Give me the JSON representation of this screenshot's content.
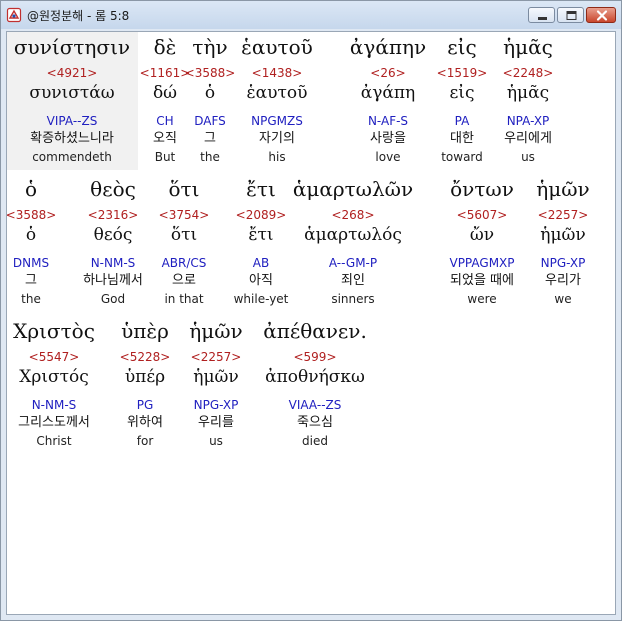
{
  "window": {
    "title": "@원정분해 - 롬 5:8",
    "icon": "bible-app-icon",
    "buttons": [
      "minimize-icon",
      "maximize-icon",
      "close-icon"
    ]
  },
  "colors": {
    "strongs": "#b02020",
    "morph": "#2020c0",
    "text": "#111111",
    "highlight": "#f1f1f1"
  },
  "lines": [
    {
      "words": [
        {
          "greek": "συνίστησιν",
          "strongs": "<4921>",
          "lemma": "συνιστάω",
          "morph": "VIPA--ZS",
          "korean": "확증하셨느니라",
          "english": "commendeth"
        },
        {
          "greek": "δὲ",
          "strongs": "<1161>",
          "lemma": "δώ",
          "morph": "CH",
          "korean": "오직",
          "english": "But"
        },
        {
          "greek": "τὴν",
          "strongs": "<3588>",
          "lemma": "ὁ",
          "morph": "DAFS",
          "korean": "그",
          "english": "the"
        },
        {
          "greek": "ἑαυτοῦ",
          "strongs": "<1438>",
          "lemma": "ἑαυτοῦ",
          "morph": "NPGMZS",
          "korean": "자기의",
          "english": "his"
        },
        {
          "greek": "ἀγάπην",
          "strongs": "<26>",
          "lemma": "ἀγάπη",
          "morph": "N-AF-S",
          "korean": "사랑을",
          "english": "love"
        },
        {
          "greek": "εἰς",
          "strongs": "<1519>",
          "lemma": "εἰς",
          "morph": "PA",
          "korean": "대한",
          "english": "toward"
        },
        {
          "greek": "ἡμᾶς",
          "strongs": "<2248>",
          "lemma": "ἡμᾶς",
          "morph": "NPA-XP",
          "korean": "우리에게",
          "english": "us"
        }
      ]
    },
    {
      "words": [
        {
          "greek": "ὁ",
          "strongs": "<3588>",
          "lemma": "ὁ",
          "morph": "DNMS",
          "korean": "그",
          "english": "the"
        },
        {
          "greek": "θεὸς",
          "strongs": "<2316>",
          "lemma": "θεός",
          "morph": "N-NM-S",
          "korean": "하나님께서",
          "english": "God"
        },
        {
          "greek": "ὅτι",
          "strongs": "<3754>",
          "lemma": "ὅτι",
          "morph": "ABR/CS",
          "korean": "으로",
          "english": "in that"
        },
        {
          "greek": "ἔτι",
          "strongs": "<2089>",
          "lemma": "ἔτι",
          "morph": "AB",
          "korean": "아직",
          "english": "while-yet"
        },
        {
          "greek": "ἁμαρτωλῶν",
          "strongs": "<268>",
          "lemma": "ἁμαρτωλός",
          "morph": "A--GM-P",
          "korean": "죄인",
          "english": "sinners"
        },
        {
          "greek": "ὄντων",
          "strongs": "<5607>",
          "lemma": "ὤν",
          "morph": "VPPAGMXP",
          "korean": "되었을 때에",
          "english": "were"
        },
        {
          "greek": "ἡμῶν",
          "strongs": "<2257>",
          "lemma": "ἡμῶν",
          "morph": "NPG-XP",
          "korean": "우리가",
          "english": "we"
        }
      ]
    },
    {
      "words": [
        {
          "greek": "Χριστὸς",
          "strongs": "<5547>",
          "lemma": "Χριστός",
          "morph": "N-NM-S",
          "korean": "그리스도께서",
          "english": "Christ"
        },
        {
          "greek": "ὑπὲρ",
          "strongs": "<5228>",
          "lemma": "ὑπέρ",
          "morph": "PG",
          "korean": "위하여",
          "english": "for"
        },
        {
          "greek": "ἡμῶν",
          "strongs": "<2257>",
          "lemma": "ἡμῶν",
          "morph": "NPG-XP",
          "korean": "우리를",
          "english": "us"
        },
        {
          "greek": "ἀπέθανεν.",
          "strongs": "<599>",
          "lemma": "ἀποθνήσκω",
          "morph": "VIAA--ZS",
          "korean": "죽으심",
          "english": "died"
        }
      ]
    }
  ]
}
